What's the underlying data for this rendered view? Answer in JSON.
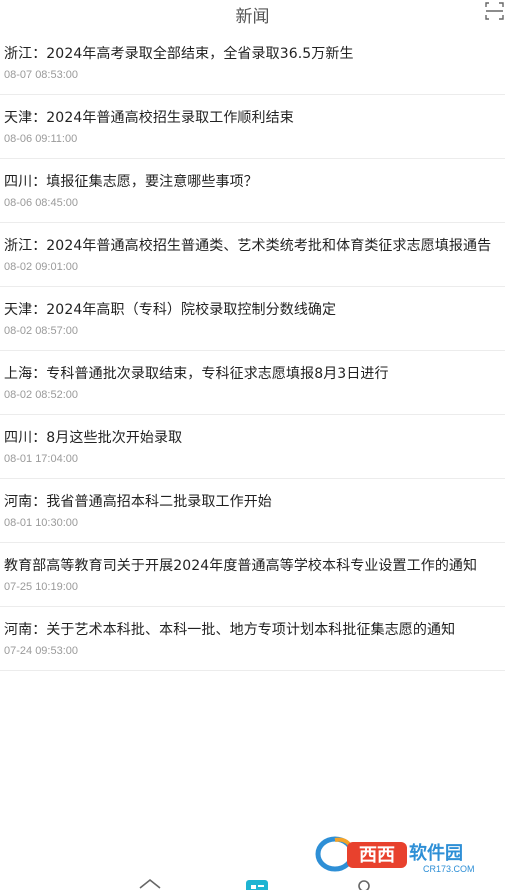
{
  "header": {
    "title": "新闻",
    "scan_icon": "scan-icon"
  },
  "news": [
    {
      "title": "浙江：2024年高考录取全部结束，全省录取36.5万新生",
      "time": "08-07 08:53:00"
    },
    {
      "title": "天津：2024年普通高校招生录取工作顺利结束",
      "time": "08-06 09:11:00"
    },
    {
      "title": "四川：填报征集志愿，要注意哪些事项？",
      "time": "08-06 08:45:00"
    },
    {
      "title": "浙江：2024年普通高校招生普通类、艺术类统考批和体育类征求志愿填报通告",
      "time": "08-02 09:01:00"
    },
    {
      "title": "天津：2024年高职（专科）院校录取控制分数线确定",
      "time": "08-02 08:57:00"
    },
    {
      "title": "上海：专科普通批次录取结束，专科征求志愿填报8月3日进行",
      "time": "08-02 08:52:00"
    },
    {
      "title": "四川：8月这些批次开始录取",
      "time": "08-01 17:04:00"
    },
    {
      "title": "河南：我省普通高招本科二批录取工作开始",
      "time": "08-01 10:30:00"
    },
    {
      "title": "教育部高等教育司关于开展2024年度普通高等学校本科专业设置工作的通知",
      "time": "07-25 10:19:00"
    },
    {
      "title": "河南：关于艺术本科批、本科一批、地方专项计划本科批征集志愿的通知",
      "time": "07-24 09:53:00"
    }
  ],
  "tabbar": {
    "icons": [
      "home-icon",
      "news-icon",
      "profile-icon"
    ],
    "active_color": "#1fb4d2"
  },
  "watermark": {
    "brand": "西西软件园",
    "domain": "CR173.COM"
  }
}
